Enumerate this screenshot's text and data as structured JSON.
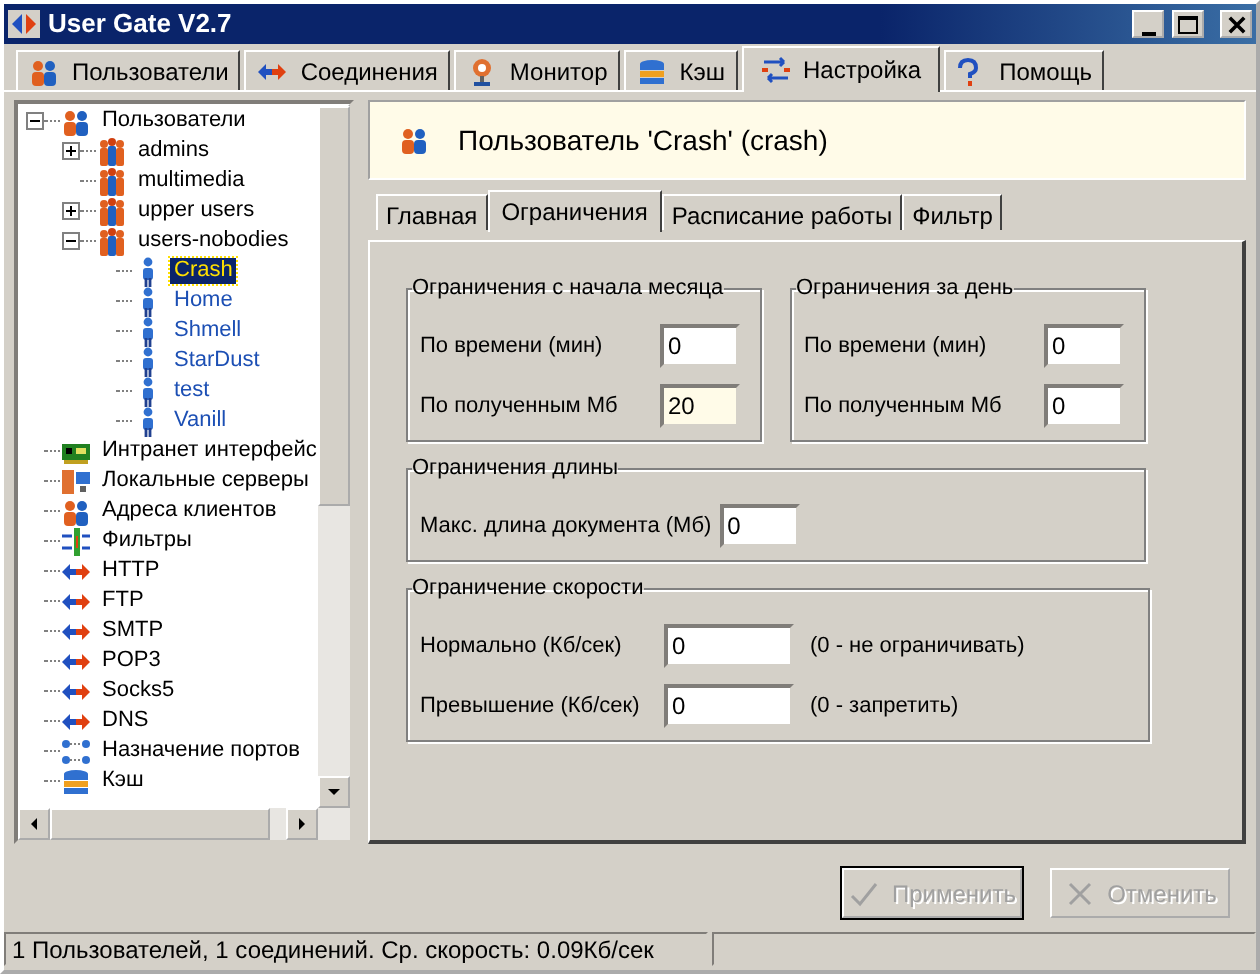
{
  "window": {
    "title": "User Gate V2.7"
  },
  "main_tabs": [
    {
      "label": "Пользователи",
      "kind": "users",
      "selected": false
    },
    {
      "label": "Соединения",
      "kind": "arrows",
      "selected": false
    },
    {
      "label": "Монитор",
      "kind": "monitor",
      "selected": false
    },
    {
      "label": "Кэш",
      "kind": "cache",
      "selected": false
    },
    {
      "label": "Настройка",
      "kind": "settings",
      "selected": true
    },
    {
      "label": "Помощь",
      "kind": "help",
      "selected": false
    }
  ],
  "tree": [
    {
      "label": "Пользователи",
      "kind": "clients",
      "expanded": true,
      "selected": false,
      "children": [
        {
          "label": "admins",
          "kind": "group",
          "expanded": false,
          "selected": false
        },
        {
          "label": "multimedia",
          "kind": "group",
          "selected": false
        },
        {
          "label": "upper users",
          "kind": "group",
          "expanded": false,
          "selected": false
        },
        {
          "label": "users-nobodies",
          "kind": "group",
          "expanded": true,
          "selected": false,
          "children": [
            {
              "label": "Crash",
              "kind": "user",
              "selected": true
            },
            {
              "label": "Home",
              "kind": "user",
              "selected": false
            },
            {
              "label": "Shmell",
              "kind": "user",
              "selected": false
            },
            {
              "label": "StarDust",
              "kind": "user",
              "selected": false
            },
            {
              "label": "test",
              "kind": "user",
              "selected": false
            },
            {
              "label": "Vanill",
              "kind": "user",
              "selected": false
            }
          ]
        }
      ]
    },
    {
      "label": "Интранет интерфейс",
      "kind": "network",
      "selected": false
    },
    {
      "label": "Локальные серверы",
      "kind": "servers",
      "selected": false
    },
    {
      "label": "Адреса клиентов",
      "kind": "clients",
      "selected": false
    },
    {
      "label": "Фильтры",
      "kind": "filter",
      "selected": false
    },
    {
      "label": "HTTP",
      "kind": "protocol",
      "selected": false
    },
    {
      "label": "FTP",
      "kind": "protocol",
      "selected": false
    },
    {
      "label": "SMTP",
      "kind": "protocol",
      "selected": false
    },
    {
      "label": "POP3",
      "kind": "protocol",
      "selected": false
    },
    {
      "label": "Socks5",
      "kind": "protocol",
      "selected": false
    },
    {
      "label": "DNS",
      "kind": "protocol",
      "selected": false
    },
    {
      "label": "Назначение портов",
      "kind": "ports",
      "selected": false
    },
    {
      "label": "Кэш",
      "kind": "cache",
      "selected": false
    }
  ],
  "panel": {
    "title": "Пользователь 'Crash' (crash)",
    "tabs": [
      {
        "label": "Главная",
        "selected": false
      },
      {
        "label": "Ограничения",
        "selected": true
      },
      {
        "label": "Расписание работы",
        "selected": false
      },
      {
        "label": "Фильтр",
        "selected": false
      }
    ],
    "groups": [
      {
        "title": "Ограничения с начала месяца",
        "kind": "half",
        "fields": [
          {
            "label": "По времени (мин)",
            "value": "0",
            "highlighted": false
          },
          {
            "label": "По полученным Мб",
            "value": "20",
            "highlighted": true
          }
        ]
      },
      {
        "title": "Ограничения за день",
        "kind": "half",
        "fields": [
          {
            "label": "По времени (мин)",
            "value": "0",
            "highlighted": false
          },
          {
            "label": "По полученным Мб",
            "value": "0",
            "highlighted": false
          }
        ]
      },
      {
        "title": "Ограничения длины",
        "kind": "full",
        "fields": [
          {
            "label": "Макс. длина документа (Мб)",
            "value": "0",
            "highlighted": false
          }
        ]
      },
      {
        "title": "Ограничение скорости",
        "kind": "wide",
        "fields": [
          {
            "label": "Нормально (Кб/сек)",
            "value": "0",
            "highlighted": false,
            "note": "(0 - не ограничивать)"
          },
          {
            "label": "Превышение (Кб/сек)",
            "value": "0",
            "highlighted": false,
            "note": "(0 - запретить)"
          }
        ]
      }
    ]
  },
  "buttons": [
    {
      "label": "Применить",
      "kind": "apply",
      "disabled": true
    },
    {
      "label": "Отменить",
      "kind": "cancel",
      "disabled": true
    }
  ],
  "status_bar": {
    "text": "1 Пользователей, 1 соединений. Ср. скорость: 0.09Кб/сек"
  }
}
